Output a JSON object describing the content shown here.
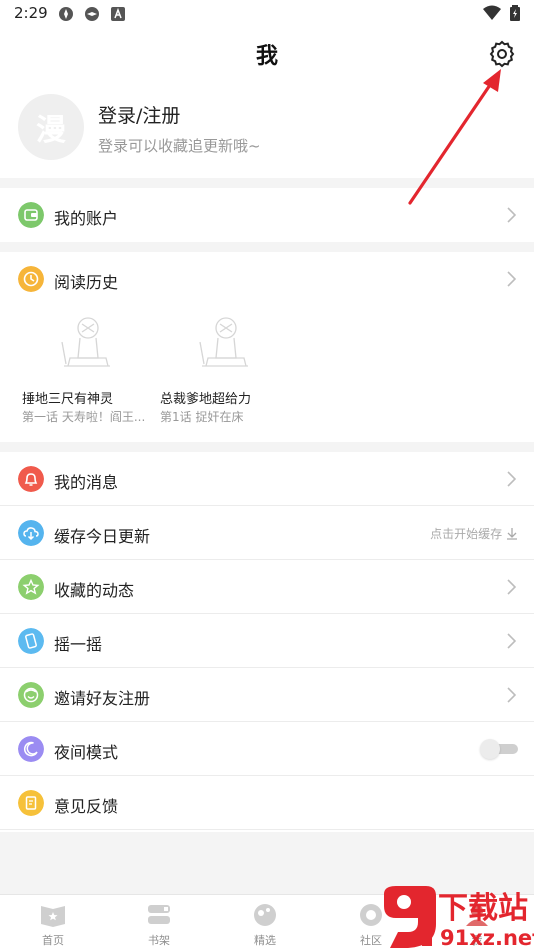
{
  "status_bar": {
    "time": "2:29"
  },
  "header": {
    "title": "我",
    "login_label": "登录/注册",
    "login_sub": "登录可以收藏追更新哦~",
    "avatar_char": "漫"
  },
  "account": {
    "label": "我的账户"
  },
  "history": {
    "label": "阅读历史",
    "books": [
      {
        "title": "捶地三尺有神灵",
        "subtitle": "第一话 天寿啦！阎王..."
      },
      {
        "title": "总裁爹地超给力",
        "subtitle": "第1话 捉奸在床"
      }
    ]
  },
  "menu": {
    "messages": "我的消息",
    "cache": "缓存今日更新",
    "cache_hint": "点击开始缓存",
    "favorites": "收藏的动态",
    "shake": "摇一摇",
    "invite": "邀请好友注册",
    "night": "夜间模式",
    "feedback": "意见反馈"
  },
  "night_mode": {
    "enabled": false
  },
  "tabs": [
    "首页",
    "书架",
    "精选",
    "社区",
    "我"
  ],
  "watermark": {
    "top": "下载站",
    "bottom": "91xz.net"
  },
  "colors": {
    "account_icon": "#7dc86b",
    "history_icon": "#f6b53a",
    "messages_icon": "#f05a4c",
    "cache_icon": "#55b4ee",
    "favorites_icon": "#8ccf6e",
    "shake_icon": "#5cbaf0",
    "invite_icon": "#8ccf6e",
    "night_icon": "#9b8cf2",
    "feedback_icon": "#f6c13a",
    "annotation_arrow": "#e3262e"
  }
}
